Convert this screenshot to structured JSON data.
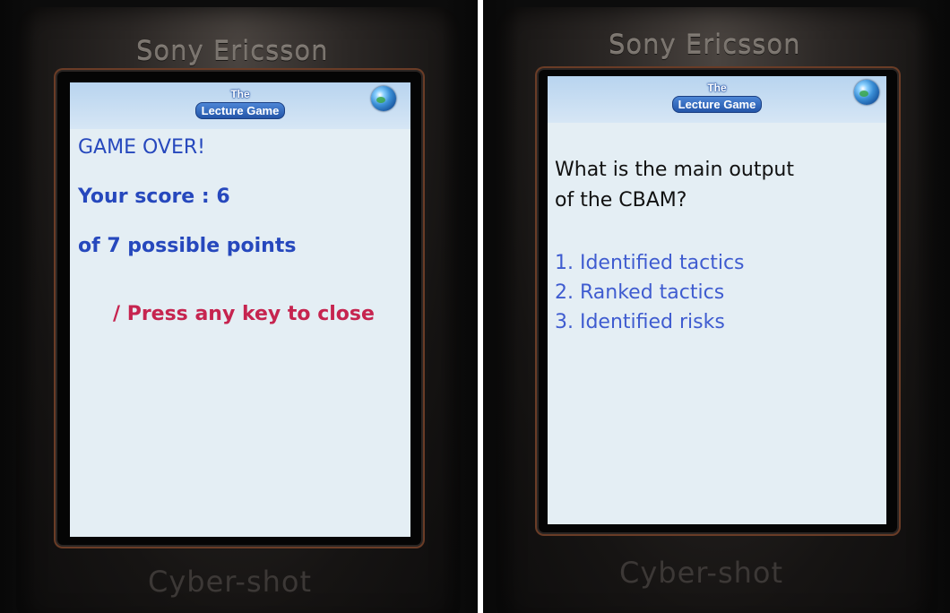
{
  "left_phone": {
    "brand": "Sony Ericsson",
    "model": "Cyber-shot",
    "title_line1": "The",
    "title_line2": "Lecture Game",
    "globe_icon": "globe-icon",
    "heading": "GAME OVER!",
    "score_line": "Your score : 6",
    "points_line": "of 7 possible points",
    "prompt": "/ Press any key to close"
  },
  "right_phone": {
    "brand": "Sony Ericsson",
    "model": "Cyber-shot",
    "title_line1": "The",
    "title_line2": "Lecture Game",
    "globe_icon": "globe-icon",
    "question_line1": "What is the main output",
    "question_line2": "of the CBAM?",
    "options": [
      "1. Identified tactics",
      "2. Ranked tactics",
      "3. Identified risks"
    ]
  },
  "colors": {
    "heading_blue": "#2648bd",
    "prompt_red": "#c6244f",
    "option_blue": "#3f5cd0",
    "screen_bg": "#e4eef4"
  }
}
